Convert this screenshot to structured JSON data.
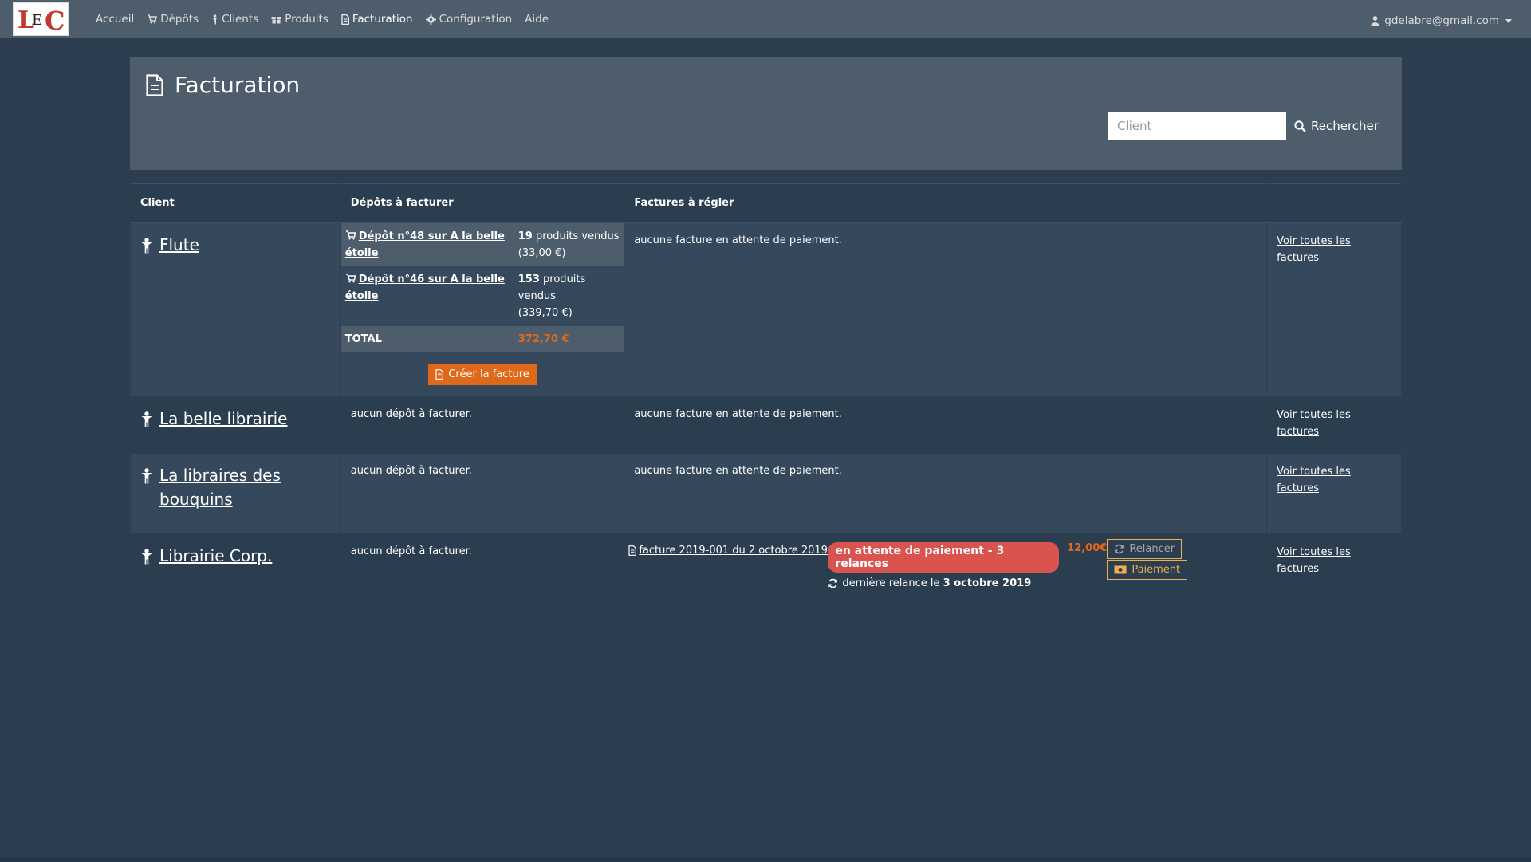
{
  "nav": {
    "logo_text": "LEC",
    "items": [
      {
        "label": "Accueil",
        "icon": "none"
      },
      {
        "label": "Dépôts",
        "icon": "cart-icon"
      },
      {
        "label": "Clients",
        "icon": "person-icon"
      },
      {
        "label": "Produits",
        "icon": "gift-icon"
      },
      {
        "label": "Facturation",
        "icon": "document-icon",
        "active": true
      },
      {
        "label": "Configuration",
        "icon": "gear-icon"
      },
      {
        "label": "Aide",
        "icon": "none"
      }
    ],
    "user_email": "gdelabre@gmail.com"
  },
  "header": {
    "title": "Facturation",
    "search_placeholder": "Client",
    "search_button": "Rechercher"
  },
  "table": {
    "columns": [
      "Client",
      "Dépôts à facturer",
      "Factures à régler",
      ""
    ],
    "rows": [
      {
        "client": "Flute",
        "depots": [
          {
            "label": "Dépôt n°48 sur A la belle étoile",
            "count": "19",
            "count_label": "produits vendus",
            "amount": "(33,00 €)"
          },
          {
            "label": "Dépôt n°46 sur A la belle étoile",
            "count": "153",
            "count_label": "produits vendus",
            "amount": "(339,70 €)"
          }
        ],
        "total_label": "TOTAL",
        "total_value": "372,70 €",
        "create_button": "Créer la facture",
        "invoices_text": "aucune facture en attente de paiement.",
        "see_all": "Voir toutes les factures"
      },
      {
        "client": "La belle librairie",
        "depots_text": "aucun dépôt à facturer.",
        "invoices_text": "aucune facture en attente de paiement.",
        "see_all": "Voir toutes les factures"
      },
      {
        "client": "La libraires des bouquins",
        "depots_text": "aucun dépôt à facturer.",
        "invoices_text": "aucune facture en attente de paiement.",
        "see_all": "Voir toutes les factures"
      },
      {
        "client": "Librairie Corp.",
        "depots_text": "aucun dépôt à facturer.",
        "invoice": {
          "label": "facture 2019-001 du 2 octobre 2019",
          "status": "en attente de paiement - 3 relances",
          "amount": "12,00€",
          "last_reminder_prefix": "dernière relance le",
          "last_reminder_date": "3 octobre 2019",
          "remind_button": "Relancer",
          "pay_button": "Paiement"
        },
        "see_all": "Voir toutes les factures"
      }
    ]
  },
  "colors": {
    "background": "#2c3e50",
    "navbar": "#4e5d6c",
    "accent_orange": "#df691a",
    "status_red": "#d9534f",
    "warning": "#f0ad4e"
  }
}
